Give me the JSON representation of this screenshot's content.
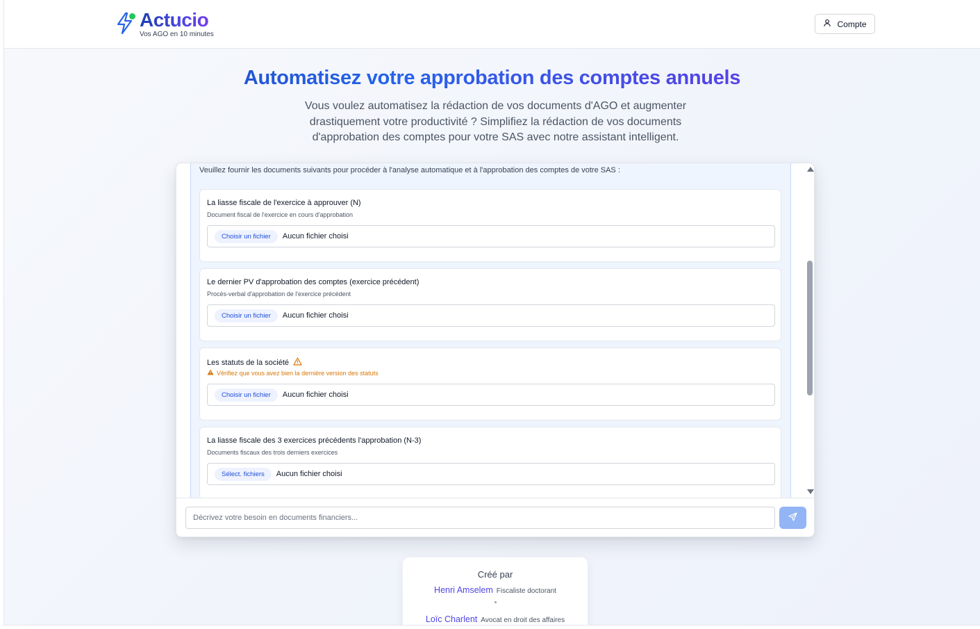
{
  "header": {
    "brand_name": "Actucio",
    "brand_tagline": "Vos AGO en 10 minutes",
    "account_label": "Compte"
  },
  "hero": {
    "title": "Automatisez votre approbation des comptes annuels",
    "subtitle": "Vous voulez automatisez la rédaction de vos documents d'AGO et augmenter drastiquement votre productivité ? Simplifiez la rédaction de vos documents d'approbation des comptes pour votre SAS avec notre assistant intelligent."
  },
  "chat": {
    "intro": "Veuillez fournir les documents suivants pour procéder à l'analyse automatique et à l'approbation des comptes de votre SAS :",
    "documents": [
      {
        "title": "La liasse fiscale de l'exercice à approuver (N)",
        "description": "Document fiscal de l'exercice en cours d'approbation",
        "button": "Choisir un fichier",
        "status": "Aucun fichier choisi"
      },
      {
        "title": "Le dernier PV d'approbation des comptes (exercice précédent)",
        "description": "Procès-verbal d'approbation de l'exercice précédent",
        "button": "Choisir un fichier",
        "status": "Aucun fichier choisi"
      },
      {
        "title": "Les statuts de la société",
        "warning": "Vérifiez que vous avez bien la dernière version des statuts",
        "button": "Choisir un fichier",
        "status": "Aucun fichier choisi"
      },
      {
        "title": "La liasse fiscale des 3 exercices précédents l'approbation (N-3)",
        "description": "Documents fiscaux des trois derniers exercices",
        "button": "Sélect. fichiers",
        "status": "Aucun fichier choisi"
      }
    ],
    "input_placeholder": "Décrivez votre besoin en documents financiers..."
  },
  "credits": {
    "title": "Créé par",
    "people": [
      {
        "name": "Henri Amselem",
        "role": "Fiscaliste doctorant"
      },
      {
        "name": "Loïc Charlent",
        "role": "Avocat en droit des affaires"
      }
    ]
  },
  "colors": {
    "brand_blue": "#1e40af",
    "brand_purple": "#7c3aed",
    "logo_dot": "#22c55e",
    "warning": "#d97706",
    "send_button": "#93b4f5"
  }
}
